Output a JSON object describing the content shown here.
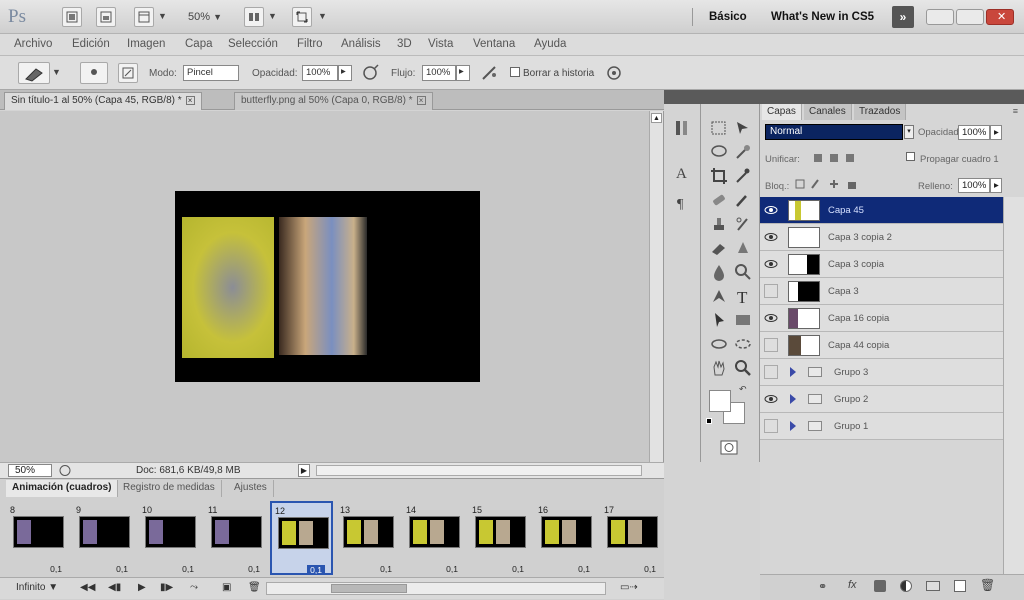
{
  "app": {
    "logo": "Ps",
    "zoom_select": "50%",
    "workspace_basic": "Básico",
    "whats_new": "What's New in CS5",
    "extend_glyph": "»"
  },
  "menu": [
    "Archivo",
    "Edición",
    "Imagen",
    "Capa",
    "Selección",
    "Filtro",
    "Análisis",
    "3D",
    "Vista",
    "Ventana",
    "Ayuda"
  ],
  "options": {
    "mode_label": "Modo:",
    "mode_value": "Pincel",
    "opacity_label": "Opacidad:",
    "opacity_value": "100%",
    "flow_label": "Flujo:",
    "flow_value": "100%",
    "erase_history_label": "Borrar a historia"
  },
  "doc_tabs": [
    {
      "label": "Sin título-1 al 50% (Capa 45, RGB/8) *"
    },
    {
      "label": "butterfly.png al 50% (Capa 0, RGB/8) *"
    }
  ],
  "status": {
    "zoom": "50%",
    "doc_info": "Doc: 681,6 KB/49,8 MB"
  },
  "animation": {
    "tabs": [
      "Animación (cuadros)",
      "Registro de medidas",
      "Ajustes"
    ],
    "frames": [
      {
        "num": "8",
        "delay": "0,1"
      },
      {
        "num": "9",
        "delay": "0,1"
      },
      {
        "num": "10",
        "delay": "0,1"
      },
      {
        "num": "11",
        "delay": "0,1"
      },
      {
        "num": "12",
        "delay": "0,1"
      },
      {
        "num": "13",
        "delay": "0,1"
      },
      {
        "num": "14",
        "delay": "0,1"
      },
      {
        "num": "15",
        "delay": "0,1"
      },
      {
        "num": "16",
        "delay": "0,1"
      },
      {
        "num": "17",
        "delay": "0,1"
      }
    ],
    "selected_frame": 4,
    "loop": "Infinito"
  },
  "layers_panel": {
    "tabs": [
      "Capas",
      "Canales",
      "Trazados"
    ],
    "blend_mode": "Normal",
    "opacity_label": "Opacidad:",
    "opacity_value": "100%",
    "unify_label": "Unificar:",
    "propagate_label": "Propagar cuadro 1",
    "lock_label": "Bloq.:",
    "fill_label": "Relleno:",
    "fill_value": "100%",
    "layers": [
      {
        "name": "Capa 45",
        "visible": true,
        "active": true,
        "kind": "layer"
      },
      {
        "name": "Capa 3 copia 2",
        "visible": true,
        "active": false,
        "kind": "layer"
      },
      {
        "name": "Capa 3 copia",
        "visible": true,
        "active": false,
        "kind": "layer"
      },
      {
        "name": "Capa 3",
        "visible": false,
        "active": false,
        "kind": "layer"
      },
      {
        "name": "Capa 16 copia",
        "visible": true,
        "active": false,
        "kind": "layer"
      },
      {
        "name": "Capa 44 copia",
        "visible": false,
        "active": false,
        "kind": "layer"
      },
      {
        "name": "Grupo 3",
        "visible": false,
        "active": false,
        "kind": "group"
      },
      {
        "name": "Grupo 2",
        "visible": true,
        "active": false,
        "kind": "group"
      },
      {
        "name": "Grupo 1",
        "visible": false,
        "active": false,
        "kind": "group"
      }
    ]
  },
  "colors": {
    "selection_blue": "#0f2a78",
    "frame_select": "#2a55b0",
    "photo_yellow": "#c8c832"
  }
}
